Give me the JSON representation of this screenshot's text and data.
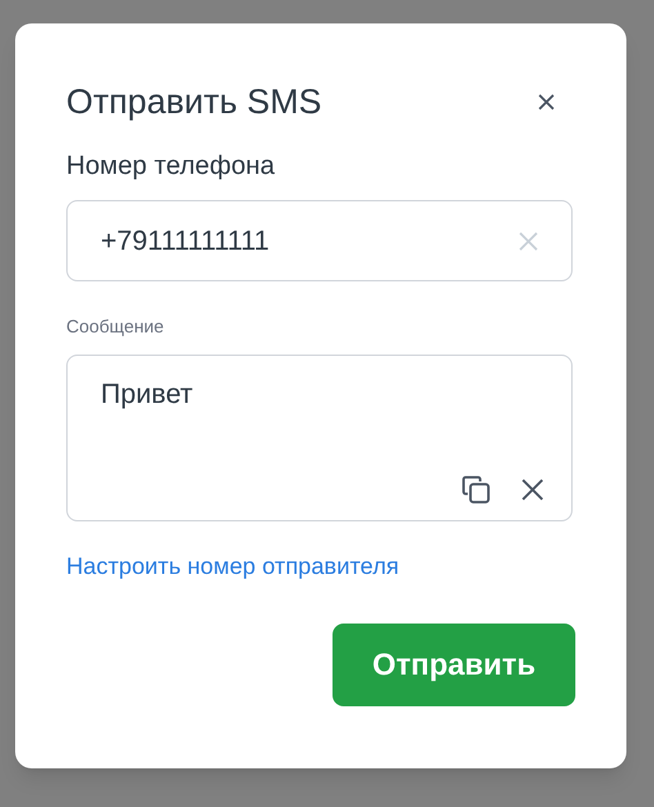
{
  "dialog": {
    "title": "Отправить SMS"
  },
  "phone": {
    "label": "Номер телефона",
    "value": "+79111111111"
  },
  "message": {
    "label": "Сообщение",
    "value": "Привет"
  },
  "sender_link": "Настроить номер отправителя",
  "send_button": "Отправить"
}
